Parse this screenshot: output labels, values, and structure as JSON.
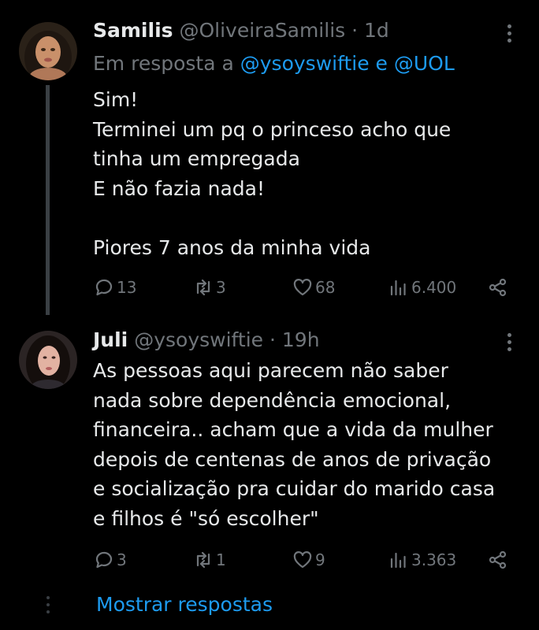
{
  "tweets": [
    {
      "name": "Samilis",
      "handle": "@OliveiraSamilis",
      "separator": "·",
      "time": "1d",
      "reply_prefix": "Em resposta a",
      "reply_mentions": "@ysoyswiftie e @UOL",
      "text": "Sim!\nTerminei um pq o princeso acho que\ntinha um empregada\nE não fazia nada!\n\nPiores 7 anos da minha vida",
      "replies": "13",
      "retweets": "3",
      "likes": "68",
      "views": "6.400"
    },
    {
      "name": "Juli",
      "handle": "@ysoyswiftie",
      "separator": "·",
      "time": "19h",
      "text": "As pessoas aqui parecem não saber\nnada sobre dependência emocional,\nfinanceira.. acham que a vida da mulher\ndepois de centenas de anos de privação\ne socialização pra cuidar do marido casa\ne filhos é \"só escolher\"",
      "replies": "3",
      "retweets": "1",
      "likes": "9",
      "views": "3.363"
    }
  ],
  "show_replies": "Mostrar respostas",
  "icons": [
    "more-icon",
    "reply-icon",
    "retweet-icon",
    "like-icon",
    "views-icon",
    "share-icon"
  ],
  "colors": {
    "background": "#000000",
    "text": "#e7e9ea",
    "secondary": "#71767b",
    "link": "#1d9bf0"
  }
}
